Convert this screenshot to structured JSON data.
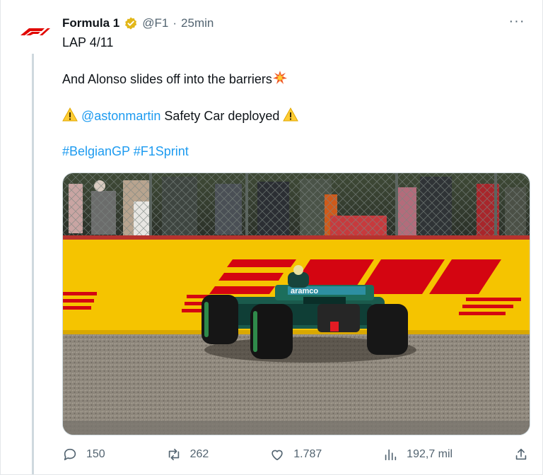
{
  "author": {
    "display_name": "Formula 1",
    "handle": "@F1",
    "separator": "·",
    "time": "25min",
    "brand_color": "#e10600",
    "verified_color": "#e2b719"
  },
  "tweet": {
    "line1": "LAP 4/11",
    "line2": "And Alonso slides off into the barriers",
    "line2_emoji": "collision-emoji",
    "line3_mention": "@astonmartin",
    "line3_text": " Safety Car deployed ",
    "line3_emoji": "warning-emoji",
    "hashtag1": "#BelgianGP",
    "hashtag2": "#F1Sprint",
    "link_color": "#1d9bf0"
  },
  "media": {
    "description_icon": "race-photo",
    "sponsor_text": "aramco",
    "barrier_color": "#f5c400",
    "logo_color": "#d40511"
  },
  "actions": {
    "replies": "150",
    "reposts": "262",
    "likes": "1.787",
    "views": "192,7 mil"
  }
}
